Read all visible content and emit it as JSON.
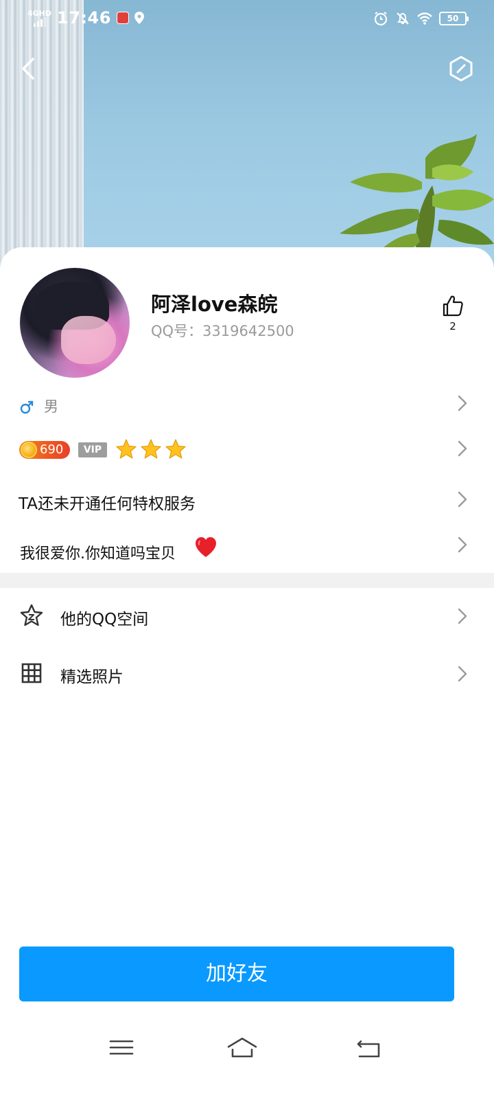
{
  "status_bar": {
    "network": "4GHD",
    "time": "17:46",
    "battery": "50",
    "icons": [
      "signal-icon",
      "app-notification-icon",
      "location-icon",
      "alarm-icon",
      "mute-bell-icon",
      "wifi-icon",
      "battery-icon"
    ]
  },
  "header": {
    "back_icon": "chevron-left-icon",
    "settings_icon": "hexagon-settings-icon"
  },
  "profile": {
    "nickname": "阿泽love森皖",
    "qq_number": "QQ号：3319642500",
    "like_count": "2",
    "gender": "男",
    "level": "690",
    "vip_tag": "VIP",
    "star_count": 3,
    "privilege_text": "TA还未开通任何特权服务",
    "signature": "我很爱你.你知道吗宝贝"
  },
  "menu": {
    "qzone_label": "他的QQ空间",
    "photos_label": "精选照片"
  },
  "actions": {
    "add_friend_label": "加好友"
  },
  "colors": {
    "primary_button": "#0a99ff",
    "gender_icon": "#2a8cd8",
    "divider": "#f1f1f1"
  }
}
